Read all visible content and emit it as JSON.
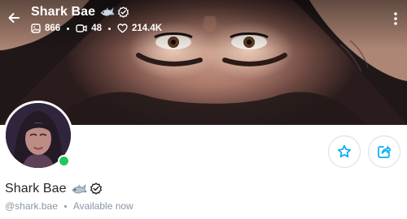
{
  "cover": {
    "display_name": "Shark Bae",
    "stats": {
      "photos": "866",
      "videos": "48",
      "likes": "214.4K"
    }
  },
  "profile": {
    "display_name": "Shark Bae",
    "username": "@shark.bae",
    "status": "Available now"
  },
  "colors": {
    "accent": "#00aff0",
    "online": "#22c55e",
    "muted_text": "#8a96a3"
  },
  "icons": {
    "back": "arrow-left-icon",
    "more": "more-vertical-icon",
    "photos": "image-icon",
    "videos": "video-icon",
    "likes": "heart-icon",
    "favorite": "star-icon",
    "share": "share-icon",
    "shark_emoji": "shark-emoji-icon",
    "verified": "verified-badge-icon"
  }
}
